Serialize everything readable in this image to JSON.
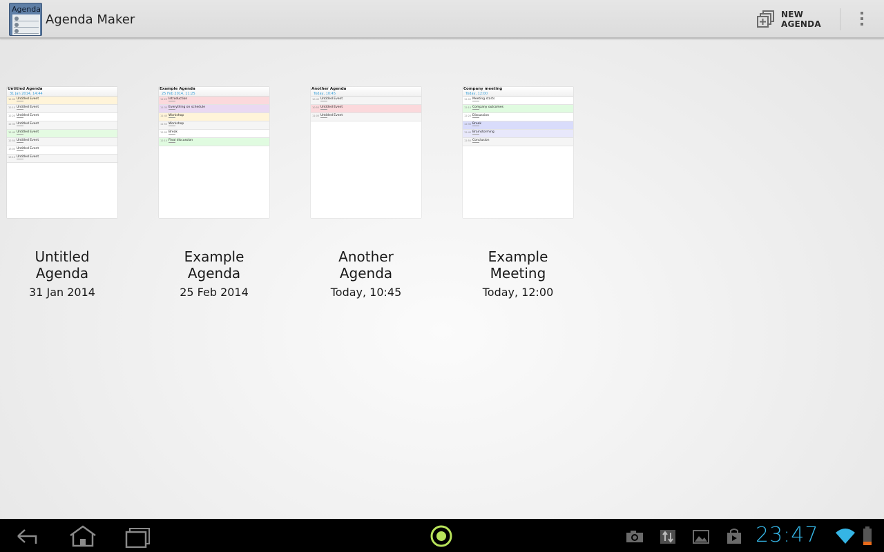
{
  "app": {
    "title": "Agenda Maker",
    "icon_text": "Agenda"
  },
  "actionbar": {
    "new_agenda_label": "NEW AGENDA",
    "new_agenda_icon": "add-document-icon",
    "overflow_icon": "overflow-menu-icon"
  },
  "agendas": [
    {
      "title_line1": "Untitled",
      "title_line2": "Agenda",
      "date": "31 Jan 2014",
      "preview_title": "Untitled Agenda",
      "preview_date": "31 Jan 2014, 14:44",
      "rows": [
        {
          "time": "12:00",
          "text": "Untitled Event",
          "color": "#fff4d9"
        },
        {
          "time": "12:10",
          "text": "Untitled Event",
          "color": "#f5f5f5"
        },
        {
          "time": "12:20",
          "text": "Untitled Event",
          "color": "#ffffff"
        },
        {
          "time": "12:30",
          "text": "Untitled Event",
          "color": "#f5f5f5"
        },
        {
          "time": "12:40",
          "text": "Untitled Event",
          "color": "#e4fbe2"
        },
        {
          "time": "12:50",
          "text": "Untitled Event",
          "color": "#f5f5f5"
        },
        {
          "time": "13:00",
          "text": "Untitled Event",
          "color": "#ffffff"
        },
        {
          "time": "13:10",
          "text": "Untitled Event",
          "color": "#f5f5f5"
        }
      ]
    },
    {
      "title_line1": "Example",
      "title_line2": "Agenda",
      "date": "25 Feb 2014",
      "preview_title": "Example Agenda",
      "preview_date": "25 Feb 2014, 11:25",
      "rows": [
        {
          "time": "11:25",
          "text": "Introduction",
          "color": "#fbd9dc"
        },
        {
          "time": "11:35",
          "text": "Everything on schedule",
          "color": "#ead9f2"
        },
        {
          "time": "11:45",
          "text": "Workshop",
          "color": "#fff4d9"
        },
        {
          "time": "11:55",
          "text": "Workshop",
          "color": "#f5f5f5"
        },
        {
          "time": "12:05",
          "text": "Break",
          "color": "#ffffff"
        },
        {
          "time": "12:15",
          "text": "Final discussion",
          "color": "#e0fbe0"
        }
      ]
    },
    {
      "title_line1": "Another",
      "title_line2": "Agenda",
      "date": "Today, 10:45",
      "preview_title": "Another Agenda",
      "preview_date": "Today, 10:45",
      "rows": [
        {
          "time": "10:45",
          "text": "Untitled Event",
          "color": "#f5f5f5"
        },
        {
          "time": "10:55",
          "text": "Untitled Event",
          "color": "#fbd9dc"
        },
        {
          "time": "11:05",
          "text": "Untitled Event",
          "color": "#f5f5f5"
        }
      ]
    },
    {
      "title_line1": "Example",
      "title_line2": "Meeting",
      "date": "Today, 12:00",
      "preview_title": "Company meeting",
      "preview_date": "Today, 12:00",
      "rows": [
        {
          "time": "12:00",
          "text": "Meeting starts",
          "color": "#ffffff"
        },
        {
          "time": "12:10",
          "text": "Company outcomes",
          "color": "#e0fbe0"
        },
        {
          "time": "12:20",
          "text": "Discussion",
          "color": "#ffffff"
        },
        {
          "time": "12:30",
          "text": "Break",
          "color": "#d9dcfb"
        },
        {
          "time": "12:40",
          "text": "Brainstorming",
          "color": "#e8e8fb"
        },
        {
          "time": "12:50",
          "text": "Conclusion",
          "color": "#f5f5f5"
        }
      ]
    }
  ],
  "navbar": {
    "back_icon": "back-icon",
    "home_icon": "home-icon",
    "recents_icon": "recent-apps-icon",
    "center_icon": "record-icon",
    "status_icons": [
      "camera-icon",
      "data-transfer-icon",
      "gallery-icon",
      "shopping-bag-icon",
      "wifi-icon",
      "battery-icon"
    ],
    "clock": "23:47",
    "accent_color": "#35b5e5",
    "center_color": "#b8e35a"
  }
}
